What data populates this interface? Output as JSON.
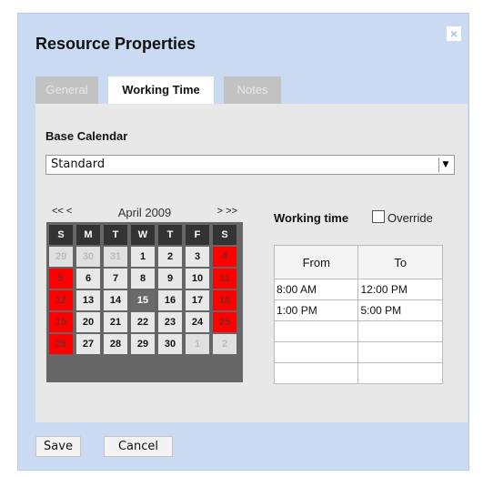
{
  "dialog": {
    "title": "Resource Properties",
    "close_icon": "×"
  },
  "tabs": [
    {
      "label": "General",
      "active": false
    },
    {
      "label": "Working Time",
      "active": true
    },
    {
      "label": "Notes",
      "active": false
    }
  ],
  "base_calendar": {
    "label": "Base Calendar",
    "selected": "Standard"
  },
  "calendar": {
    "prev_label": "<< <",
    "title": "April 2009",
    "next_label": "> >>",
    "weekdays": [
      "S",
      "M",
      "T",
      "W",
      "T",
      "F",
      "S"
    ],
    "weeks": [
      [
        "29",
        "30",
        "31",
        "1",
        "2",
        "3",
        "4"
      ],
      [
        "5",
        "6",
        "7",
        "8",
        "9",
        "10",
        "11"
      ],
      [
        "12",
        "13",
        "14",
        "15",
        "16",
        "17",
        "18"
      ],
      [
        "19",
        "20",
        "21",
        "22",
        "23",
        "24",
        "25"
      ],
      [
        "26",
        "27",
        "28",
        "29",
        "30",
        "1",
        "2"
      ]
    ],
    "today": "15",
    "colors": {
      "weekend": "#ff0000",
      "today": "#6a6a6a",
      "header": "#333333"
    }
  },
  "working_time": {
    "label": "Working time",
    "override_label": "Override",
    "override_checked": false,
    "columns": [
      "From",
      "To"
    ],
    "rows": [
      [
        "8:00 AM",
        "12:00 PM"
      ],
      [
        "1:00 PM",
        "5:00 PM"
      ],
      [
        "",
        ""
      ],
      [
        "",
        ""
      ],
      [
        "",
        ""
      ]
    ]
  },
  "footer": {
    "save_label": "Save",
    "cancel_label": "Cancel"
  }
}
